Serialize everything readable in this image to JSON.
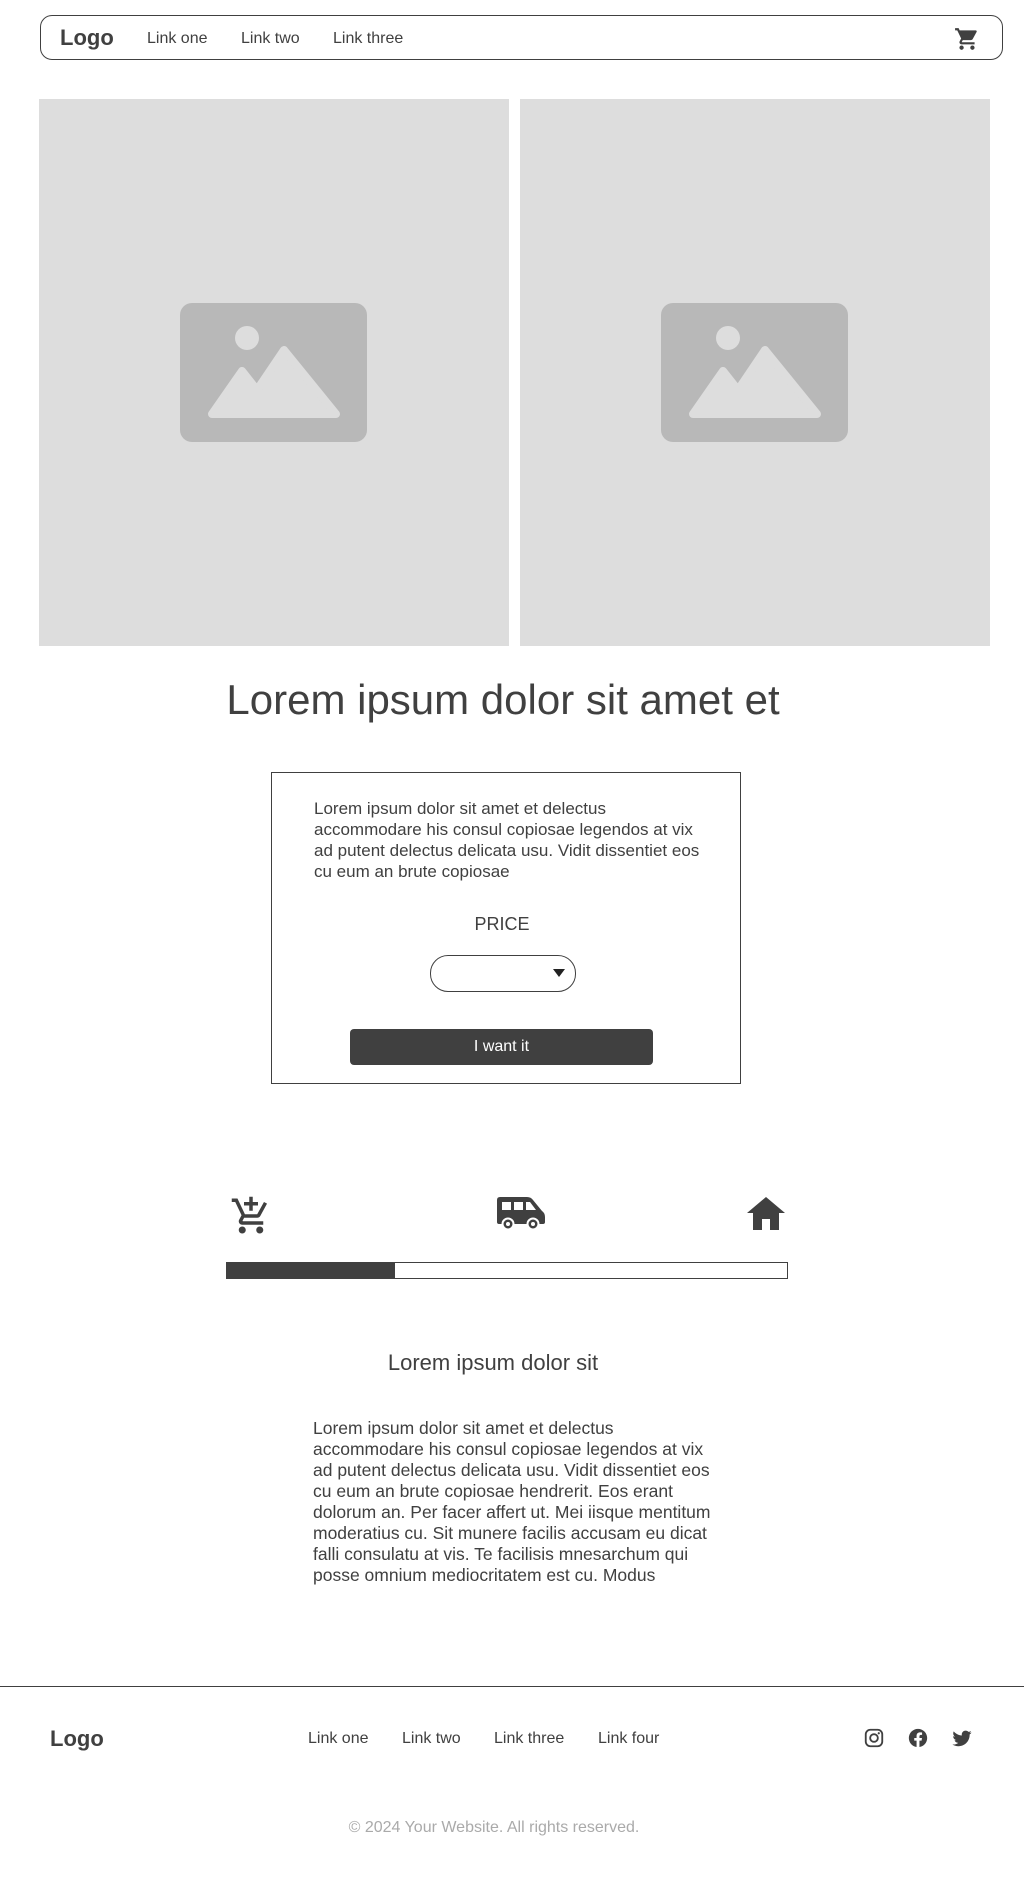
{
  "navbar": {
    "logo": "Logo",
    "links": [
      "Link one",
      "Link two",
      "Link three"
    ],
    "cart_icon": "cart-icon"
  },
  "hero": {
    "image_icon": "image-placeholder-icon",
    "title": "Lorem ipsum dolor sit amet et"
  },
  "product": {
    "description": "Lorem ipsum dolor sit amet et delectus accommodare his consul copiosae legendos at vix ad putent delectus delicata usu. Vidit dissentiet eos cu eum an brute copiosae",
    "price_label": "PRICE",
    "select_value": "",
    "button_label": "I want it"
  },
  "steps": {
    "icons": [
      "cart-add-icon",
      "delivery-van-icon",
      "home-icon"
    ],
    "progress_fraction": 0.3
  },
  "info": {
    "title": "Lorem ipsum dolor sit",
    "text": "Lorem ipsum dolor sit amet et delectus accommodare his consul copiosae legendos at vix ad putent delectus delicata usu. Vidit dissentiet eos cu eum an brute copiosae hendrerit. Eos erant dolorum an. Per facer affert ut. Mei iisque mentitum moderatius cu. Sit munere facilis accusam eu dicat falli consulatu at vis. Te facilisis mnesarchum qui posse omnium mediocritatem est cu. Modus"
  },
  "footer": {
    "logo": "Logo",
    "links": [
      "Link one",
      "Link two",
      "Link three",
      "Link four"
    ],
    "social_icons": [
      "instagram-icon",
      "facebook-icon",
      "twitter-icon"
    ],
    "copyright": "© 2024 Your Website. All rights reserved."
  },
  "colors": {
    "text": "#404040",
    "placeholder_bg": "#dddddd",
    "placeholder_icon": "#b8b8b8",
    "muted": "#aaaaaa",
    "button_bg": "#404040",
    "button_text": "#ffffff"
  }
}
